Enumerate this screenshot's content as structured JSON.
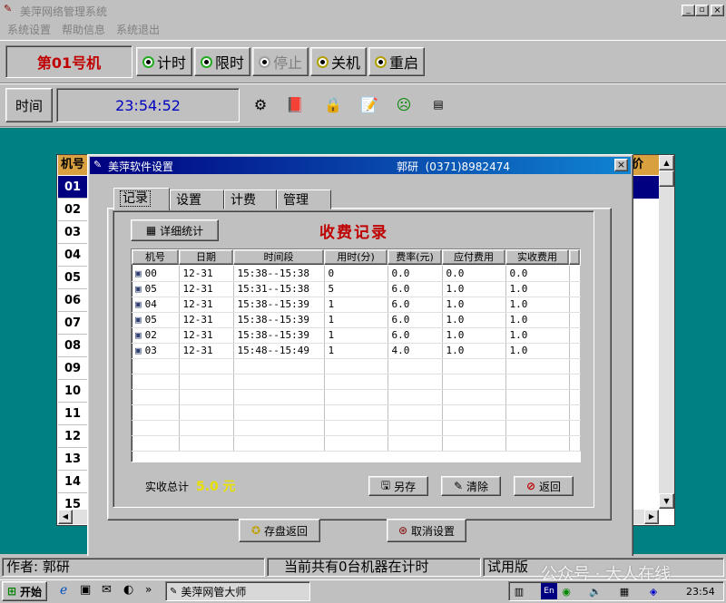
{
  "app": {
    "title": "美萍网络管理系统",
    "menu": [
      "系统设置",
      "帮助信息",
      "系统退出"
    ]
  },
  "toolbar": {
    "machine": "第01号机",
    "buttons": [
      "计时",
      "限时",
      "停止",
      "关机",
      "重启"
    ]
  },
  "timebar": {
    "label": "时间",
    "value": "23:54:52"
  },
  "grid": {
    "col_header": "机号",
    "right_header": "价",
    "rows": [
      "01",
      "02",
      "03",
      "04",
      "05",
      "06",
      "07",
      "08",
      "09",
      "10",
      "11",
      "12",
      "13",
      "14",
      "15"
    ]
  },
  "status": {
    "author": "作者: 郭研",
    "running": "当前共有0台机器在计时",
    "version": "试用版"
  },
  "dialog": {
    "title": "美萍软件设置",
    "contact": "郭研  (0371)8982474",
    "tabs": [
      "记录",
      "设置",
      "计费",
      "管理"
    ],
    "detail_button": "详细统计",
    "heading": "收费记录",
    "columns": [
      "机号",
      "日期",
      "时间段",
      "用时(分)",
      "费率(元)",
      "应付费用",
      "实收费用"
    ],
    "rows": [
      [
        "00",
        "12-31",
        "15:38--15:38",
        "0",
        "0.0",
        "0.0",
        "0.0"
      ],
      [
        "05",
        "12-31",
        "15:31--15:38",
        "5",
        "6.0",
        "1.0",
        "1.0"
      ],
      [
        "04",
        "12-31",
        "15:38--15:39",
        "1",
        "6.0",
        "1.0",
        "1.0"
      ],
      [
        "05",
        "12-31",
        "15:38--15:39",
        "1",
        "6.0",
        "1.0",
        "1.0"
      ],
      [
        "02",
        "12-31",
        "15:38--15:39",
        "1",
        "6.0",
        "1.0",
        "1.0"
      ],
      [
        "03",
        "12-31",
        "15:48--15:49",
        "1",
        "4.0",
        "1.0",
        "1.0"
      ]
    ],
    "total_label": "实收总计",
    "total_value": "5.0 元",
    "buttons": {
      "save_as": "另存",
      "clear": "清除",
      "back": "返回",
      "save_return": "存盘返回",
      "cancel": "取消设置"
    }
  },
  "taskbar": {
    "start": "开始",
    "task": "美萍网管大师",
    "clock": "23:54",
    "ime": "En"
  },
  "watermark": "公众号 · 大人在线"
}
